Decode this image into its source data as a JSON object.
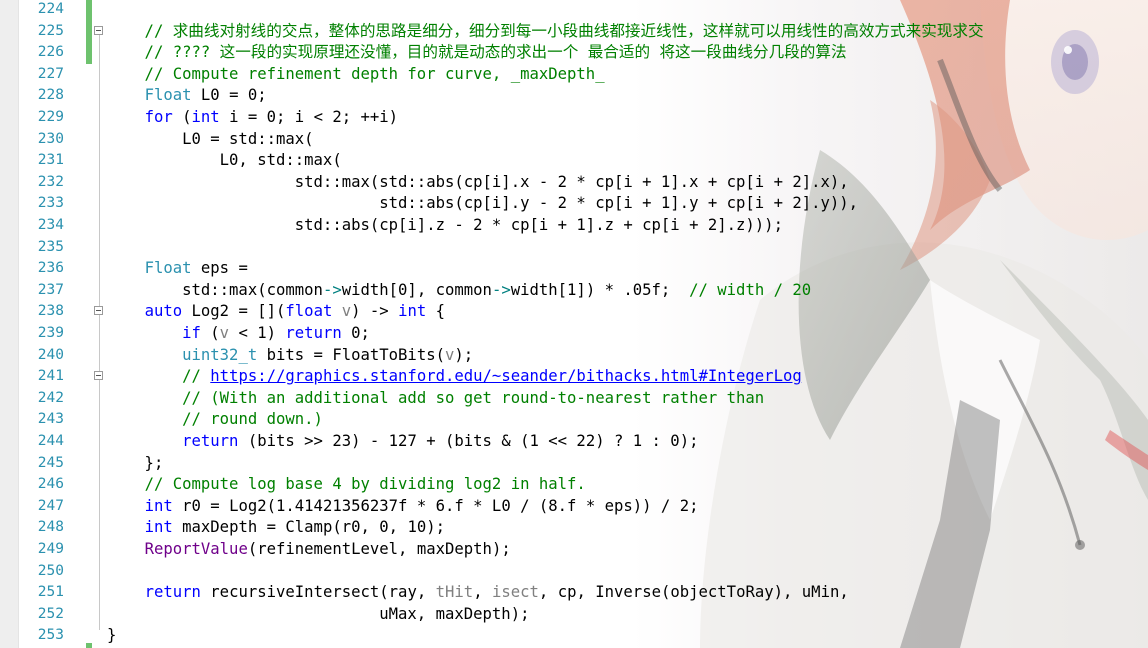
{
  "editor": {
    "line_numbers": [
      "224",
      "225",
      "226",
      "227",
      "228",
      "229",
      "230",
      "231",
      "232",
      "233",
      "234",
      "235",
      "236",
      "237",
      "238",
      "239",
      "240",
      "241",
      "242",
      "243",
      "244",
      "245",
      "246",
      "247",
      "248",
      "249",
      "250",
      "251",
      "252",
      "253"
    ],
    "lines": {
      "l225_comment": "    // 求曲线对射线的交点，整体的思路是细分，细分到每一小段曲线都接近线性，这样就可以用线性的高效方式来实现求交",
      "l226_comment": "    // ???? 这一段的实现原理还没懂，目的就是动态的求出一个 最合适的 将这一段曲线分几段的算法",
      "l227_comment": "    // Compute refinement depth for curve, _maxDepth_",
      "l228_type": "Float",
      "l228_rest": " L0 = 0;",
      "l229_for": "for",
      "l229_a": " (",
      "l229_int": "int",
      "l229_b": " i = 0; i < 2; ++i)",
      "l230": "        L0 = std::max(",
      "l231": "            L0, std::max(",
      "l232": "                    std::max(std::abs(cp[i].x - 2 * cp[i + 1].x + cp[i + 2].x),",
      "l233": "                             std::abs(cp[i].y - 2 * cp[i + 1].y + cp[i + 2].y)),",
      "l234": "                    std::abs(cp[i].z - 2 * cp[i + 1].z + cp[i + 2].z)));",
      "l236_type": "Float",
      "l236_rest": " eps =",
      "l237_a": "        std::max(common",
      "l237_arrow1": "->",
      "l237_b": "width[0], common",
      "l237_arrow2": "->",
      "l237_c": "width[1]) * .05f;  ",
      "l237_comment": "// width / 20",
      "l238_auto": "auto",
      "l238_a": " Log2 = [](",
      "l238_float": "float",
      "l238_v": "v",
      "l238_b": ") -> ",
      "l238_int": "int",
      "l238_c": " {",
      "l239_if": "if",
      "l239_a": " (",
      "l239_v": "v",
      "l239_b": " < 1) ",
      "l239_return": "return",
      "l239_c": " 0;",
      "l240_type": "uint32_t",
      "l240_a": " bits = FloatToBits(",
      "l240_v": "v",
      "l240_b": ");",
      "l241_prefix": "// ",
      "l241_link": "https://graphics.stanford.edu/~seander/bithacks.html#IntegerLog",
      "l242_comment": "// (With an additional add so get round-to-nearest rather than",
      "l243_comment": "// round down.)",
      "l244_return": "return",
      "l244_rest": " (bits >> 23) - 127 + (bits & (1 << 22) ? 1 : 0);",
      "l245": "    };",
      "l246_comment": "// Compute log base 4 by dividing log2 in half.",
      "l247_int": "int",
      "l247_rest": " r0 = Log2(1.41421356237f * 6.f * L0 / (8.f * eps)) / 2;",
      "l248_int": "int",
      "l248_rest": " maxDepth = Clamp(r0, 0, 10);",
      "l249_macro": "ReportValue",
      "l249_rest": "(refinementLevel, maxDepth);",
      "l251_return": "return",
      "l251_a": " recursiveIntersect(ray, ",
      "l251_thit": "tHit",
      "l251_b": ", ",
      "l251_isect": "isect",
      "l251_c": ", cp, Inverse(objectToRay), uMin,",
      "l252": "                             uMax, maxDepth);",
      "l253": "}"
    }
  },
  "colors": {
    "keyword": "#0000ff",
    "type": "#2b91af",
    "comment": "#008000",
    "macro": "#6f008a",
    "parameter": "#808080",
    "line_number": "#2b91af",
    "change_bar": "#6ec26e"
  },
  "icons": [
    "fold-collapse-icon"
  ]
}
